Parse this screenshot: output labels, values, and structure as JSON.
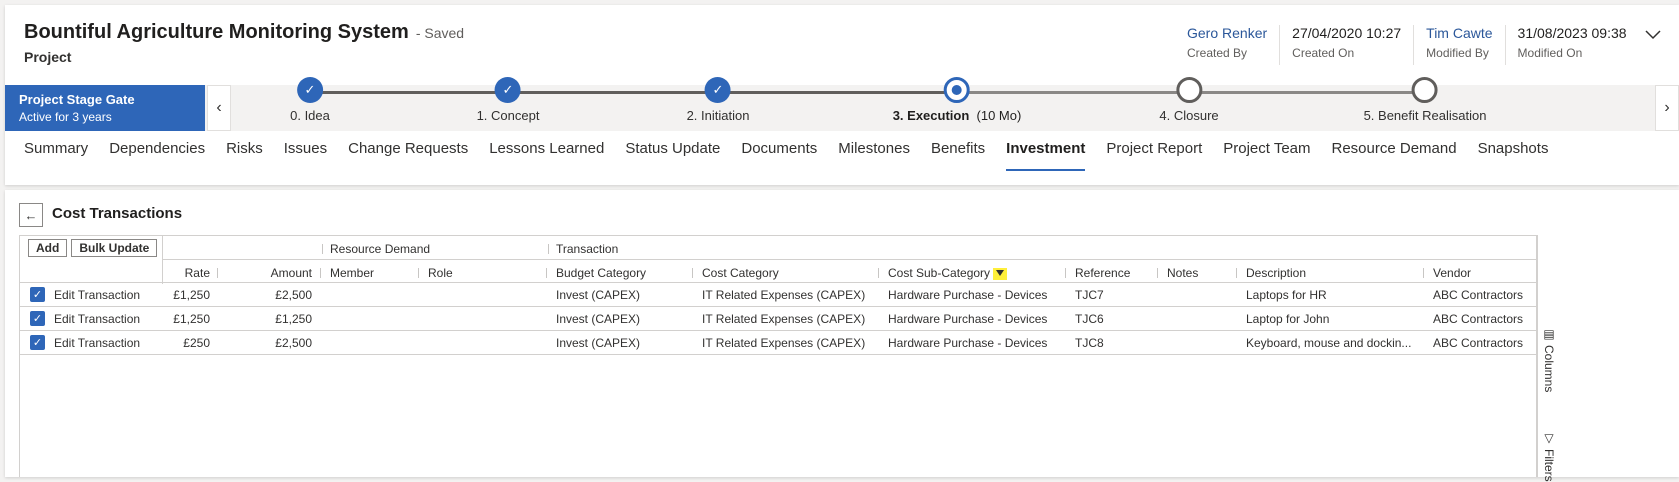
{
  "header": {
    "title": "Bountiful Agriculture Monitoring System",
    "saved_status": "- Saved",
    "entity_type": "Project",
    "fields": [
      {
        "value": "Gero Renker",
        "label": "Created By",
        "link": true
      },
      {
        "value": "27/04/2020 10:27",
        "label": "Created On",
        "link": false
      },
      {
        "value": "Tim Cawte",
        "label": "Modified By",
        "link": true
      },
      {
        "value": "31/08/2023 09:38",
        "label": "Modified On",
        "link": false
      }
    ],
    "expand_icon": "chevron-down-icon"
  },
  "stage_gate": {
    "active_name": "Project Stage Gate",
    "active_duration": "Active for 3 years",
    "stages": [
      {
        "label": "0. Idea",
        "state": "done"
      },
      {
        "label": "1. Concept",
        "state": "done"
      },
      {
        "label": "2. Initiation",
        "state": "done"
      },
      {
        "label": "3. Execution",
        "duration": "(10 Mo)",
        "state": "current"
      },
      {
        "label": "4. Closure",
        "state": "future"
      },
      {
        "label": "5. Benefit Realisation",
        "state": "future"
      }
    ]
  },
  "tabs": [
    {
      "label": "Summary"
    },
    {
      "label": "Dependencies"
    },
    {
      "label": "Risks"
    },
    {
      "label": "Issues"
    },
    {
      "label": "Change Requests"
    },
    {
      "label": "Lessons Learned"
    },
    {
      "label": "Status Update"
    },
    {
      "label": "Documents"
    },
    {
      "label": "Milestones"
    },
    {
      "label": "Benefits"
    },
    {
      "label": "Investment",
      "active": true
    },
    {
      "label": "Project Report"
    },
    {
      "label": "Project Team"
    },
    {
      "label": "Resource Demand"
    },
    {
      "label": "Snapshots"
    }
  ],
  "section": {
    "title": "Cost Transactions",
    "back_icon": "arrow-left-icon"
  },
  "grid": {
    "toolbar": {
      "add_label": "Add",
      "bulk_update_label": "Bulk Update"
    },
    "groups": {
      "resource_demand": "Resource Demand",
      "transaction": "Transaction"
    },
    "columns": {
      "rate": "Rate",
      "amount": "Amount",
      "member": "Member",
      "role": "Role",
      "budget_category": "Budget Category",
      "cost_category": "Cost Category",
      "cost_sub_category": "Cost Sub-Category",
      "reference": "Reference",
      "notes": "Notes",
      "description": "Description",
      "vendor": "Vendor"
    },
    "rows": [
      {
        "action": "Edit Transaction",
        "rate": "£1,250",
        "amount": "£2,500",
        "member": "",
        "role": "",
        "budget_category": "Invest (CAPEX)",
        "cost_category": "IT Related Expenses (CAPEX)",
        "cost_sub_category": "Hardware Purchase - Devices",
        "reference": "TJC7",
        "notes": "",
        "description": "Laptops for HR",
        "vendor": "ABC Contractors"
      },
      {
        "action": "Edit Transaction",
        "rate": "£1,250",
        "amount": "£1,250",
        "member": "",
        "role": "",
        "budget_category": "Invest (CAPEX)",
        "cost_category": "IT Related Expenses (CAPEX)",
        "cost_sub_category": "Hardware Purchase - Devices",
        "reference": "TJC6",
        "notes": "",
        "description": "Laptop for John",
        "vendor": "ABC Contractors"
      },
      {
        "action": "Edit Transaction",
        "rate": "£250",
        "amount": "£2,500",
        "member": "",
        "role": "",
        "budget_category": "Invest (CAPEX)",
        "cost_category": "IT Related Expenses (CAPEX)",
        "cost_sub_category": "Hardware Purchase - Devices",
        "reference": "TJC8",
        "notes": "",
        "description": "Keyboard, mouse and dockin...",
        "vendor": "ABC Contractors"
      }
    ]
  },
  "side_panel": {
    "columns_label": "Columns",
    "filters_label": "Filters"
  }
}
